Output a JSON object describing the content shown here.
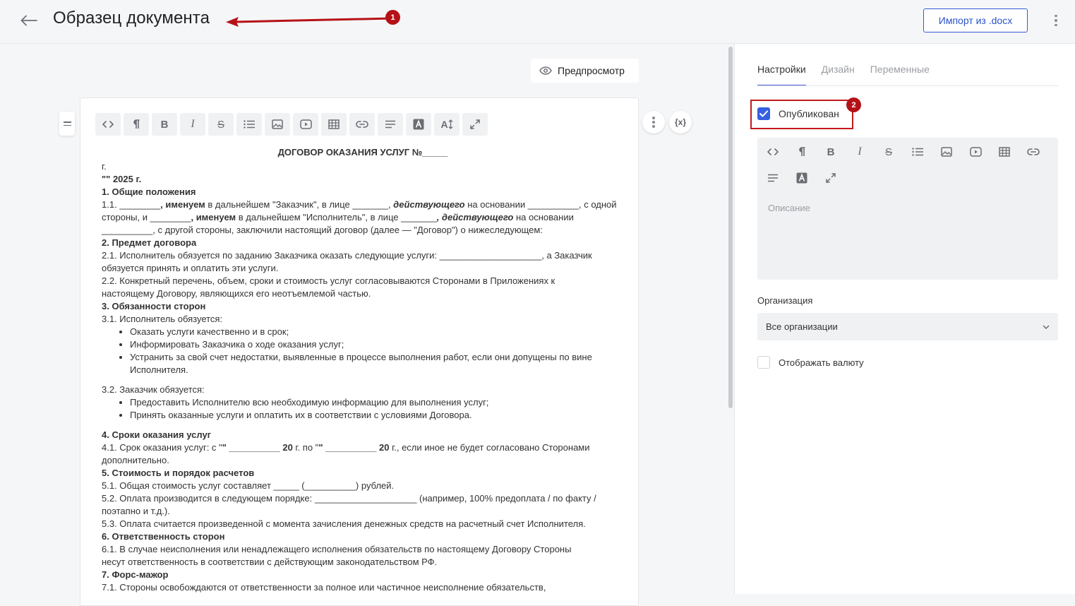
{
  "header": {
    "title": "Образец документа",
    "import_label": "Импорт из .docx"
  },
  "annotations": {
    "one": "1",
    "two": "2"
  },
  "editor": {
    "preview_label": "Предпросмотр",
    "var_label": "{x}",
    "toolbar": [
      "code-icon",
      "paragraph-icon",
      "bold-icon",
      "italic-icon",
      "strikethrough-icon",
      "bullet-list-icon",
      "image-icon",
      "video-icon",
      "table-icon",
      "link-icon",
      "align-icon",
      "text-color-icon",
      "font-size-icon",
      "expand-icon"
    ]
  },
  "document": {
    "title": "ДОГОВОР ОКАЗАНИЯ УСЛУГ №_____",
    "l1": "г.",
    "l2": "\"\" 2025 г.",
    "h1": "1. Общие положения",
    "p11a": "1.1. ________",
    "p11b": ", именуем",
    "p11c": " в дальнейшем \"Заказчик\", в лице _______, ",
    "p11d": "действующего",
    "p11e": " на основании __________, с одной",
    "p11f": "стороны, и ________",
    "p11g": ", именуем",
    "p11h": " в дальнейшем \"Исполнитель\", в лице _______",
    "p11i": ", действующего",
    "p11j": " на основании",
    "p11k": "__________, с другой стороны, заключили настоящий договор (далее — \"Договор\") о нижеследующем:",
    "h2": "2. Предмет договора",
    "p21": "2.1. Исполнитель обязуется по заданию Заказчика оказать следующие услуги: ____________________, а Заказчик",
    "p21b": "обязуется принять и оплатить эти услуги.",
    "p22": "2.2. Конкретный перечень, объем, сроки и стоимость услуг согласовываются Сторонами в Приложениях к",
    "p22b": "настоящему Договору, являющихся его неотъемлемой частью.",
    "h3": "3. Обязанности сторон",
    "p31": "3.1. Исполнитель обязуется:",
    "b31": [
      "Оказать услуги качественно и в срок;",
      "Информировать Заказчика о ходе оказания услуг;",
      "Устранить за свой счет недостатки, выявленные в процессе выполнения работ, если они допущены по вине Исполнителя."
    ],
    "p32": "3.2. Заказчик обязуется:",
    "b32": [
      "Предоставить Исполнителю всю необходимую информацию для выполнения услуг;",
      "Принять оказанные услуги и оплатить их в соответствии с условиями Договора."
    ],
    "h4": "4. Сроки оказания услуг",
    "p41a": "4.1. Срок оказания услуг: с \"",
    "p41b": "\" __________ 20",
    "p41c": " г. по \"",
    "p41d": "\" __________ 20",
    "p41e": " г., если иное не будет согласовано Сторонами",
    "p41f": "дополнительно.",
    "h5": "5. Стоимость и порядок расчетов",
    "p51": "5.1. Общая стоимость услуг составляет _____ (__________) рублей.",
    "p52": "5.2. Оплата производится в следующем порядке: ____________________ (например, 100% предоплата / по факту /",
    "p52b": "поэтапно и т.д.).",
    "p53": "5.3. Оплата считается произведенной с момента зачисления денежных средств на расчетный счет Исполнителя.",
    "h6": "6. Ответственность сторон",
    "p61": "6.1. В случае неисполнения или ненадлежащего исполнения обязательств по настоящему Договору Стороны",
    "p61b": "несут ответственность в соответствии с действующим законодательством РФ.",
    "h7": "7. Форс-мажор",
    "p71": "7.1. Стороны освобождаются от ответственности за полное или частичное неисполнение обязательств,"
  },
  "panel": {
    "tabs": [
      "Настройки",
      "Дизайн",
      "Переменные"
    ],
    "published_label": "Опубликован",
    "description_placeholder": "Описание",
    "org_label": "Организация",
    "org_value": "Все организации",
    "currency_label": "Отображать валюту"
  }
}
